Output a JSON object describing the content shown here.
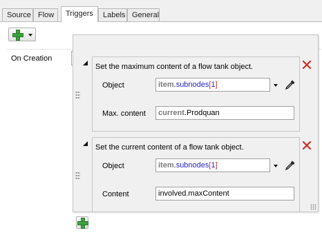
{
  "tabs": [
    {
      "label": "Source",
      "active": false
    },
    {
      "label": "Flow",
      "active": false
    },
    {
      "label": "Triggers",
      "active": true
    },
    {
      "label": "Labels",
      "active": false
    },
    {
      "label": "General",
      "active": false
    }
  ],
  "trigger": {
    "label": "On Creation"
  },
  "blocks": [
    {
      "title": "Set the maximum content of a flow tank object.",
      "object_label": "Object",
      "object_value": {
        "keyword": "item",
        "dot": ".",
        "member": "subnodes",
        "open": "[",
        "index": "1",
        "close": "]"
      },
      "value_label": "Max. content",
      "value_expr": {
        "keyword": "current",
        "rest": ".Prodquan"
      }
    },
    {
      "title": "Set the current content of a flow tank object.",
      "object_label": "Object",
      "object_value": {
        "keyword": "item",
        "dot": ".",
        "member": "subnodes",
        "open": "[",
        "index": "1",
        "close": "]"
      },
      "value_label": "Content",
      "value_expr": {
        "keyword": "",
        "rest": "involved.maxContent"
      }
    }
  ],
  "icons": {
    "add": "plus-icon",
    "dropdown": "chevron-down-icon",
    "sampler": "eyedropper-icon",
    "remove": "close-icon",
    "grip": "drag-handle-icon"
  },
  "colors": {
    "plus": "#3ea33e",
    "remove": "#d62b20",
    "keyword": "#7a7a7a",
    "member": "#2323c8",
    "bracket": "#c83232"
  }
}
